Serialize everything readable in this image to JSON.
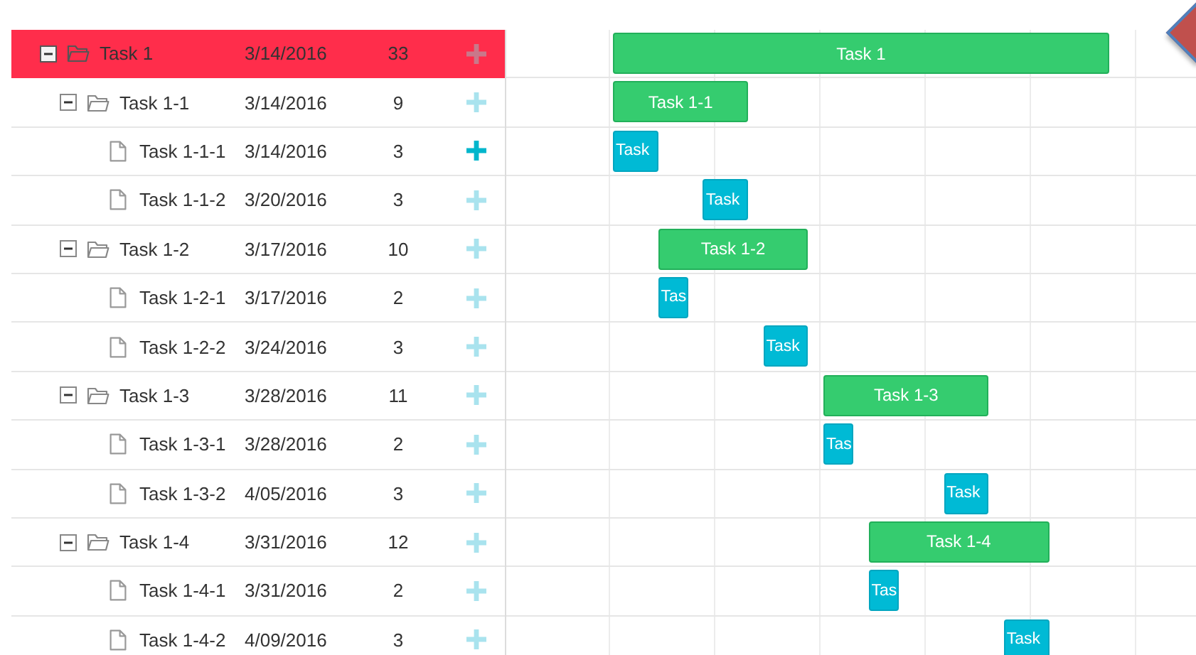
{
  "tasks": [
    {
      "kind": "summary",
      "name": "Task 1",
      "start": "3/14/2016",
      "duration": "33",
      "bar_label": "Task 1",
      "expanded": true,
      "selected": true,
      "add_active": false,
      "children": [
        {
          "kind": "summary",
          "name": "Task 1-1",
          "start": "3/14/2016",
          "duration": "9",
          "bar_label": "Task 1-1",
          "expanded": true,
          "selected": false,
          "add_active": false,
          "children": [
            {
              "kind": "task",
              "name": "Task 1-1-1",
              "start": "3/14/2016",
              "duration": "3",
              "bar_label": "Task",
              "selected": false,
              "add_active": true
            },
            {
              "kind": "task",
              "name": "Task 1-1-2",
              "start": "3/20/2016",
              "duration": "3",
              "bar_label": "Task",
              "selected": false,
              "add_active": false
            }
          ]
        },
        {
          "kind": "summary",
          "name": "Task 1-2",
          "start": "3/17/2016",
          "duration": "10",
          "bar_label": "Task 1-2",
          "expanded": true,
          "selected": false,
          "add_active": false,
          "children": [
            {
              "kind": "task",
              "name": "Task 1-2-1",
              "start": "3/17/2016",
              "duration": "2",
              "bar_label": "Tas",
              "selected": false,
              "add_active": false
            },
            {
              "kind": "task",
              "name": "Task 1-2-2",
              "start": "3/24/2016",
              "duration": "3",
              "bar_label": "Task",
              "selected": false,
              "add_active": false
            }
          ]
        },
        {
          "kind": "summary",
          "name": "Task 1-3",
          "start": "3/28/2016",
          "duration": "11",
          "bar_label": "Task 1-3",
          "expanded": true,
          "selected": false,
          "add_active": false,
          "children": [
            {
              "kind": "task",
              "name": "Task 1-3-1",
              "start": "3/28/2016",
              "duration": "2",
              "bar_label": "Tas",
              "selected": false,
              "add_active": false
            },
            {
              "kind": "task",
              "name": "Task 1-3-2",
              "start": "4/05/2016",
              "duration": "3",
              "bar_label": "Task",
              "selected": false,
              "add_active": false
            }
          ]
        },
        {
          "kind": "summary",
          "name": "Task 1-4",
          "start": "3/31/2016",
          "duration": "12",
          "bar_label": "Task 1-4",
          "expanded": true,
          "selected": false,
          "add_active": false,
          "children": [
            {
              "kind": "task",
              "name": "Task 1-4-1",
              "start": "3/31/2016",
              "duration": "2",
              "bar_label": "Tas",
              "selected": false,
              "add_active": false
            },
            {
              "kind": "task",
              "name": "Task 1-4-2",
              "start": "4/09/2016",
              "duration": "3",
              "bar_label": "Task",
              "selected": false,
              "add_active": false
            }
          ]
        }
      ]
    }
  ]
}
